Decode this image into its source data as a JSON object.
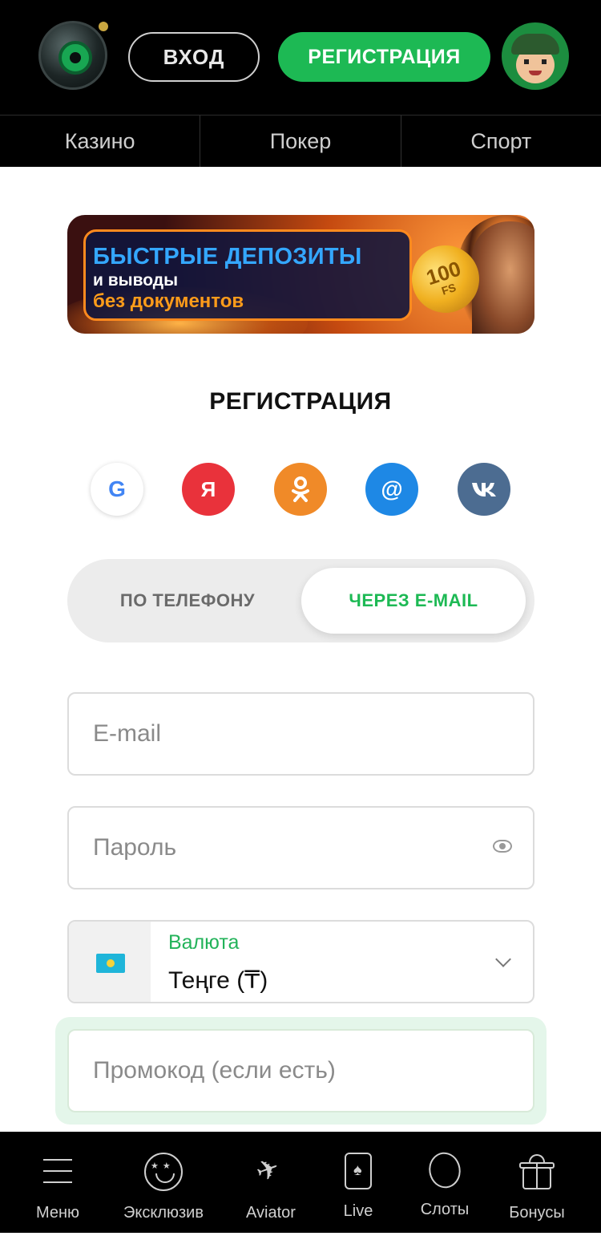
{
  "header": {
    "login_label": "ВХОД",
    "register_label": "РЕГИСТРАЦИЯ"
  },
  "topnav": {
    "items": [
      {
        "label": "Казино"
      },
      {
        "label": "Покер"
      },
      {
        "label": "Спорт"
      }
    ]
  },
  "banner": {
    "line1": "БЫСТРЫЕ ДЕПОЗИТЫ",
    "line2": "и выводы",
    "line3": "без документов",
    "coin_value": "100",
    "coin_unit": "FS"
  },
  "registration": {
    "title": "РЕГИСТРАЦИЯ",
    "social": [
      {
        "name": "google",
        "glyph": "G",
        "color": "#ffffff"
      },
      {
        "name": "yandex",
        "glyph": "Я",
        "color": "#e9323b"
      },
      {
        "name": "odnoklassniki",
        "glyph": "ок",
        "color": "#f08a28"
      },
      {
        "name": "mail",
        "glyph": "@",
        "color": "#1e88e5"
      },
      {
        "name": "vk",
        "glyph": "vk",
        "color": "#4c6c91"
      }
    ],
    "toggle": {
      "phone_label": "ПО ТЕЛЕФОНУ",
      "email_label": "ЧЕРЕЗ E-MAIL",
      "active": "email"
    },
    "email_placeholder": "E-mail",
    "password_placeholder": "Пароль",
    "currency": {
      "label": "Валюта",
      "value": "Теңге (₸)"
    },
    "promo_placeholder": "Промокод (если есть)"
  },
  "bottomnav": {
    "items": [
      {
        "label": "Меню",
        "icon": "menu-icon"
      },
      {
        "label": "Эксклюзив",
        "icon": "star-eyes-icon"
      },
      {
        "label": "Aviator",
        "icon": "plane-icon"
      },
      {
        "label": "Live",
        "icon": "card-icon"
      },
      {
        "label": "Слоты",
        "icon": "lemon-icon"
      },
      {
        "label": "Бонусы",
        "icon": "gift-icon"
      }
    ]
  },
  "colors": {
    "accent": "#1db954",
    "header_bg": "#000000"
  }
}
